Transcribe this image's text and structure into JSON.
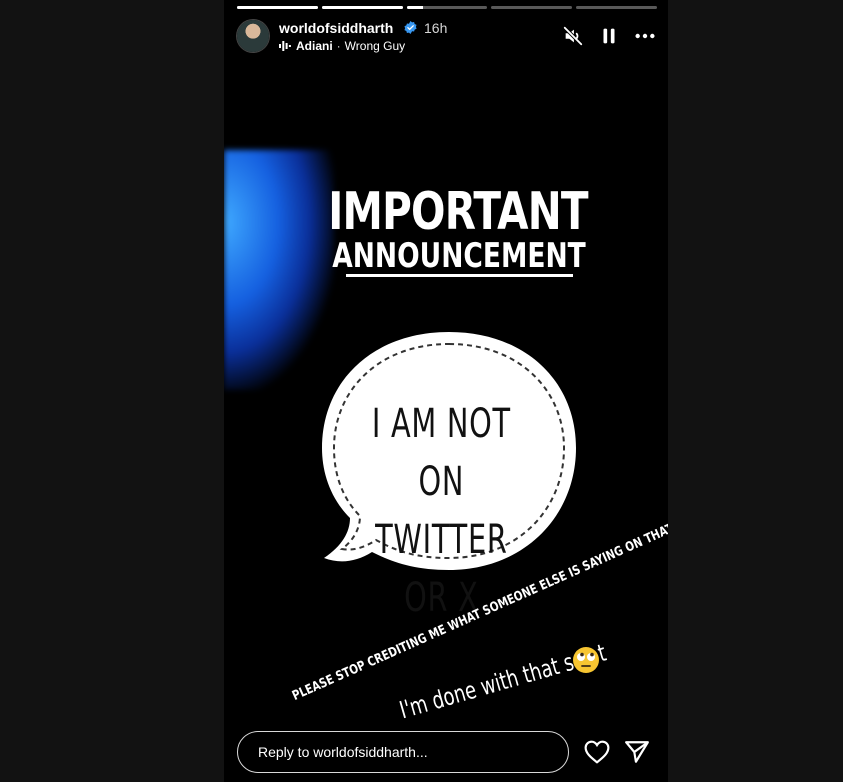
{
  "story": {
    "progress": [
      1,
      1,
      0.2,
      0,
      0
    ],
    "header": {
      "username": "worldofsiddharth",
      "time": "16h",
      "music": {
        "artist": "Adiani",
        "separator": "·",
        "song": "Wrong Guy"
      }
    },
    "media": {
      "title_line1": "IMPORTANT",
      "title_line2": "ANNOUNCEMENT",
      "bubble_line1": "I AM NOT ON",
      "bubble_line2": "TWITTER OR X",
      "caption_diagonal": "PLEASE STOP CREDITING ME WHAT SOMEONE ELSE IS SAYING ON THAT WEBSITE.",
      "caption_handwritten": "I'm done with that s¢~t"
    },
    "footer": {
      "reply_placeholder": "Reply to worldofsiddharth..."
    }
  },
  "colors": {
    "page_bg": "#121212",
    "story_bg": "#000000",
    "verified_blue": "#3897f0",
    "glow_blue": "#1560e0"
  },
  "icons": {
    "verified": "verified-badge-icon",
    "audio": "audio-wave-icon",
    "mute": "speaker-muted-icon",
    "pause": "pause-icon",
    "more": "more-horizontal-icon",
    "like": "heart-icon",
    "share": "paper-plane-icon",
    "emoji": "face-with-rolling-eyes-icon"
  }
}
